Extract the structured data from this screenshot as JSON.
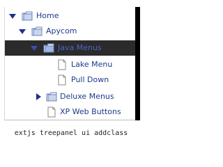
{
  "tree": {
    "items": [
      {
        "label": "Home",
        "icon": "folder-icon",
        "expander": "expanded"
      },
      {
        "label": "Apycom",
        "icon": "folder-icon",
        "expander": "expanded"
      },
      {
        "label": "Java Menus",
        "icon": "folder-icon",
        "expander": "expanded",
        "selected": true
      },
      {
        "label": "Lake Menu",
        "icon": "document-icon"
      },
      {
        "label": "Pull Down",
        "icon": "document-icon"
      },
      {
        "label": "Deluxe Menus",
        "icon": "folder-icon",
        "expander": "collapsed"
      },
      {
        "label": "XP Web Buttons",
        "icon": "document-icon"
      }
    ]
  },
  "caption": "extjs treepanel ui addclass",
  "colors": {
    "link": "#1a3b8c",
    "selected_bg": "#2b2b2b",
    "selected_text": "#4a66c8",
    "expander": "#1e2f8a"
  }
}
